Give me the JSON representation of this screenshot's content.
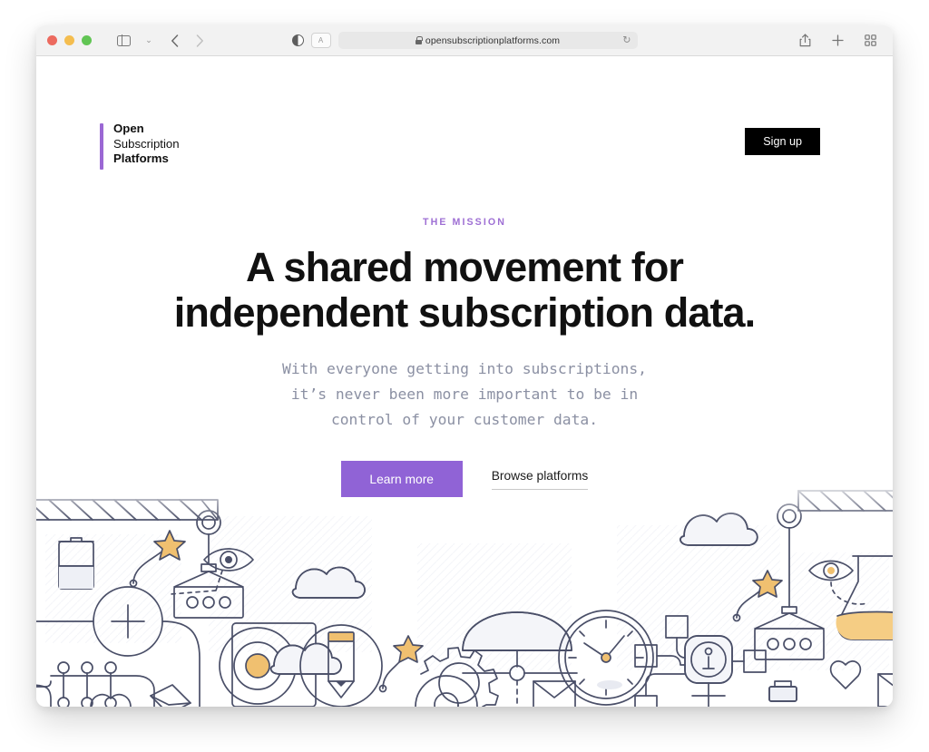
{
  "browser": {
    "traffic_lights": [
      "close",
      "minimize",
      "maximize"
    ],
    "url": "opensubscriptionplatforms.com",
    "secure": true,
    "reader_label": "A",
    "reload_glyph": "↻",
    "back_glyph": "‹",
    "forward_glyph": "›",
    "chevron_glyph": "⌄",
    "plus_glyph": "+",
    "icons": {
      "sidebar": "sidebar-icon",
      "back": "back-arrow-icon",
      "forward": "forward-arrow-icon",
      "contrast": "contrast-icon",
      "reader": "reader-view-icon",
      "lock": "lock-icon",
      "reload": "reload-icon",
      "share": "share-icon",
      "new_tab": "plus-icon",
      "tab_overview": "tab-overview-icon"
    }
  },
  "site": {
    "logo": {
      "line1": "Open",
      "line2": "Subscription",
      "line3": "Platforms",
      "accent_color": "#9b68d4"
    },
    "signup_label": "Sign up"
  },
  "hero": {
    "eyebrow": "THE MISSION",
    "headline_line1": "A shared movement for",
    "headline_line2": "independent subscription data.",
    "subhead_line1": "With everyone getting into subscriptions,",
    "subhead_line2": "it’s never been more important to be in",
    "subhead_line3": "control of your customer data.",
    "primary_cta": "Learn more",
    "secondary_cta": "Browse platforms"
  },
  "colors": {
    "purple": "#9063d6",
    "purple_eyebrow": "#9e6fd4",
    "black": "#000000",
    "subhead_gray": "#8b90a3",
    "line_art": "#4a4f68",
    "accent_orange": "#f0c070",
    "toolbar_bg": "#f2f2f2"
  },
  "illustration": {
    "style": "line-art",
    "objects": [
      "crane-left",
      "crane-right",
      "battery",
      "star-wand-left",
      "eye-left",
      "plus-circle",
      "cargo-box-left",
      "cargo-box-right",
      "connector-dots",
      "envelope-left",
      "heart-left",
      "cloud-small",
      "cloud-mid",
      "cloud-right",
      "pencil-circle",
      "target-circle",
      "gear",
      "at-circle",
      "clock",
      "info-node",
      "network-squares",
      "flask",
      "eye-right",
      "heart-right",
      "envelope-right",
      "umbrella",
      "tag"
    ]
  }
}
